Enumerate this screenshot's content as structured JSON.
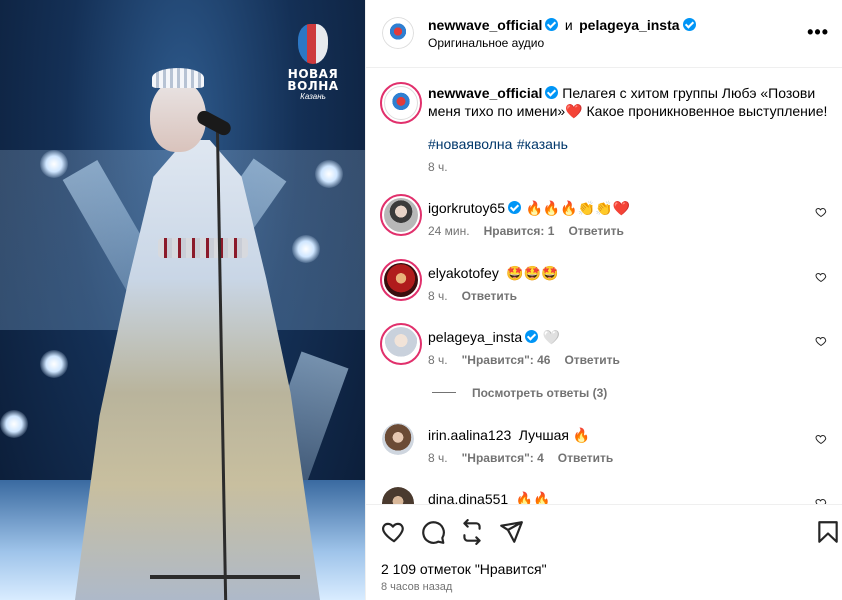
{
  "photo": {
    "logo_line1": "НОВАЯ",
    "logo_line2": "ВОЛНА",
    "logo_line3": "Казань"
  },
  "header": {
    "username": "newwave_official",
    "joiner": "и",
    "collab_username": "pelageya_insta",
    "audio": "Оригинальное аудио",
    "more_icon": "more-horizontal-icon"
  },
  "caption": {
    "username": "newwave_official",
    "text": "Пелагея с хитом группы Любэ «Позови меня тихо по имени»",
    "text_tail": " Какое проникновенное выступление!",
    "emoji": "❤️",
    "hashtags": [
      "#новаяволна",
      "#казань"
    ],
    "time": "8 ч."
  },
  "comments": [
    {
      "username": "igorkrutoy65",
      "verified": true,
      "text": "🔥🔥🔥👏👏❤️",
      "time": "24 мин.",
      "likes": "Нравится: 1",
      "reply": "Ответить"
    },
    {
      "username": "elyakotofey",
      "verified": false,
      "text": "🤩🤩🤩",
      "time": "8 ч.",
      "likes": "",
      "reply": "Ответить"
    },
    {
      "username": "pelageya_insta",
      "verified": true,
      "text": "🤍",
      "time": "8 ч.",
      "likes": "\"Нравится\": 46",
      "reply": "Ответить"
    },
    {
      "username": "irin.aalina123",
      "verified": false,
      "text": "Лучшая 🔥",
      "time": "8 ч.",
      "likes": "\"Нравится\": 4",
      "reply": "Ответить"
    },
    {
      "username": "dina.dina551",
      "verified": false,
      "text": "🔥🔥",
      "time": "",
      "likes": "",
      "reply": ""
    }
  ],
  "view_replies": "Посмотреть ответы (3)",
  "footer": {
    "likes": "2 109 отметок \"Нравится\"",
    "time": "8 часов назад"
  }
}
